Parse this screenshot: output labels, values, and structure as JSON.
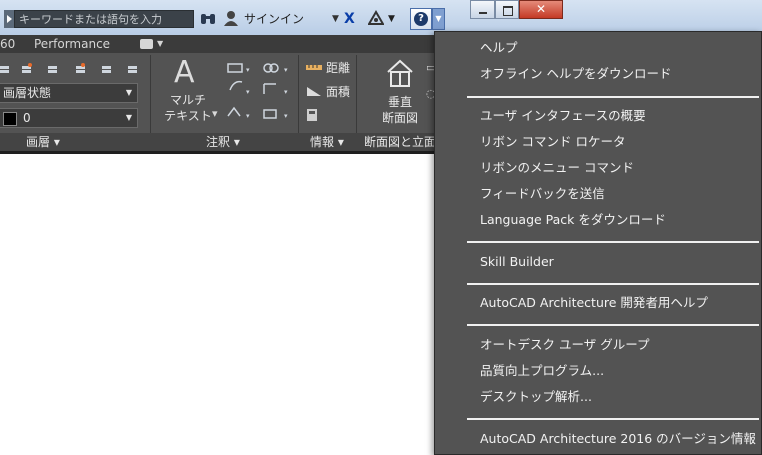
{
  "search": {
    "placeholder": "キーワードまたは語句を入力"
  },
  "top": {
    "signin": "サインイン"
  },
  "tabs": [
    "60",
    "Performance"
  ],
  "layers": {
    "state_combo": "画層状態",
    "layer_combo": "0"
  },
  "annotation": {
    "multitext_line1": "マルチ",
    "multitext_line2": "テキスト"
  },
  "info": {
    "distance": "距離",
    "area": "面積"
  },
  "section": {
    "vertical_line1": "垂直",
    "vertical_line2": "断面図"
  },
  "panel_titles": {
    "layers": "画層",
    "annotation": "注釈",
    "info": "情報",
    "section": "断面図と立面"
  },
  "menu": {
    "items": [
      "ヘルプ",
      "オフライン ヘルプをダウンロード",
      "ユーザ インタフェースの概要",
      "リボン コマンド ロケータ",
      "リボンのメニュー コマンド",
      "フィードバックを送信",
      "Language Pack をダウンロード",
      "Skill Builder",
      "AutoCAD Architecture 開発者用ヘルプ",
      "オートデスク ユーザ グループ",
      "品質向上プログラム...",
      "デスクトップ解析...",
      "AutoCAD Architecture 2016 のバージョン情報"
    ]
  },
  "icons": {
    "search_expand": "triangle-right-icon",
    "binoculars": "binoculars-icon",
    "user": "user-icon",
    "exchange": "x-exchange-icon",
    "a360": "triangle-a360-icon",
    "help": "question-icon"
  }
}
